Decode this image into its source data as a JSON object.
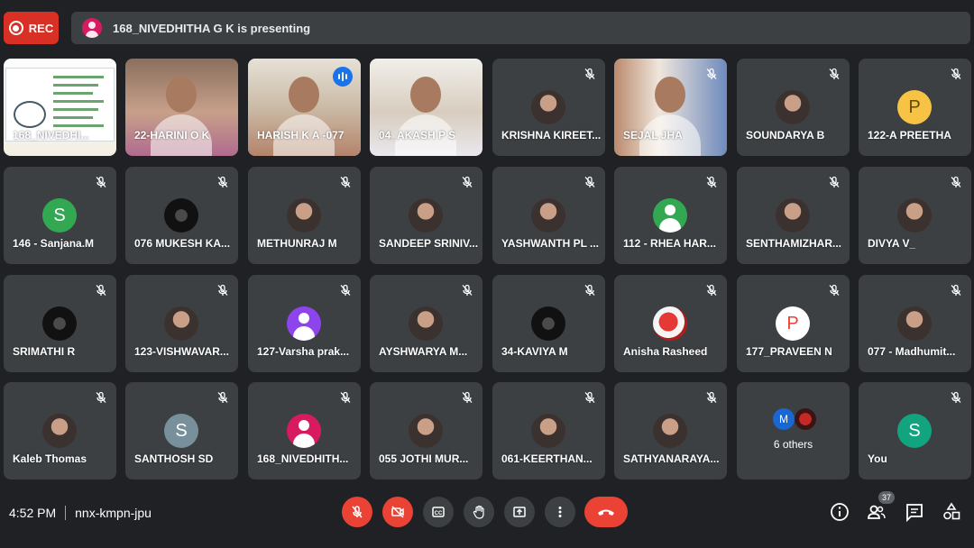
{
  "recording": {
    "label": "REC"
  },
  "presenting": {
    "text": "168_NIVEDHITHA G K is presenting"
  },
  "tiles": [
    {
      "name": "168_NIVEDHI...",
      "type": "screen",
      "muted": false
    },
    {
      "name": "22-HARINI O K",
      "type": "video",
      "muted": false
    },
    {
      "name": "HARISH K A -077",
      "type": "video",
      "muted": false,
      "speaking": true
    },
    {
      "name": "04_AKASH P S",
      "type": "video",
      "muted": false
    },
    {
      "name": "KRISHNA KIREET...",
      "type": "photo",
      "muted": true
    },
    {
      "name": "SEJAL JHA",
      "type": "video",
      "muted": true
    },
    {
      "name": "SOUNDARYA B",
      "type": "photo",
      "muted": true
    },
    {
      "name": "122-A PREETHA",
      "type": "letter",
      "letter": "P",
      "color": "#f6c344",
      "letter_color": "#5f4a00",
      "muted": true
    },
    {
      "name": "146 - Sanjana.M",
      "type": "letter",
      "letter": "S",
      "color": "#33a853",
      "muted": true
    },
    {
      "name": "076 MUKESH KA...",
      "type": "dark",
      "muted": true
    },
    {
      "name": "METHUNRAJ M",
      "type": "photo",
      "muted": true
    },
    {
      "name": "SANDEEP SRINIV...",
      "type": "photo",
      "muted": true
    },
    {
      "name": "YASHWANTH PL ...",
      "type": "photo",
      "muted": true
    },
    {
      "name": "112 - RHEA HAR...",
      "type": "generic-green",
      "muted": true
    },
    {
      "name": "SENTHAMIZHAR...",
      "type": "photo",
      "muted": true
    },
    {
      "name": "DIVYA V_",
      "type": "photo",
      "muted": true
    },
    {
      "name": "SRIMATHI R",
      "type": "dark",
      "muted": true
    },
    {
      "name": "123-VISHWAVAR...",
      "type": "photo",
      "muted": true
    },
    {
      "name": "127-Varsha prak...",
      "type": "generic-purple",
      "muted": true
    },
    {
      "name": "AYSHWARYA M...",
      "type": "photo",
      "muted": true
    },
    {
      "name": "34-KAVIYA M",
      "type": "dark",
      "muted": true
    },
    {
      "name": "Anisha Rasheed",
      "type": "photo-red",
      "muted": true
    },
    {
      "name": "177_PRAVEEN N",
      "type": "letter",
      "letter": "P",
      "color": "#ffffff",
      "letter_color": "#ea4335",
      "muted": true
    },
    {
      "name": "077 - Madhumit...",
      "type": "photo",
      "muted": true
    },
    {
      "name": "Kaleb Thomas",
      "type": "photo",
      "muted": true
    },
    {
      "name": "SANTHOSH SD",
      "type": "letter",
      "letter": "S",
      "color": "#78909c",
      "muted": true
    },
    {
      "name": "168_NIVEDHITH...",
      "type": "generic-pink",
      "muted": true
    },
    {
      "name": "055 JOTHI MUR...",
      "type": "photo",
      "muted": true
    },
    {
      "name": "061-KEERTHAN...",
      "type": "photo",
      "muted": true
    },
    {
      "name": "SATHYANARAYA...",
      "type": "photo",
      "muted": true
    },
    {
      "name": "6 others",
      "type": "others",
      "letter": "M",
      "muted": false
    },
    {
      "name": "You",
      "type": "letter",
      "letter": "S",
      "color": "#12a37f",
      "muted": true
    }
  ],
  "footer": {
    "time": "4:52 PM",
    "meeting_code": "nnx-kmpn-jpu",
    "participants_count": "37"
  },
  "colors": {
    "accent": "#8ab4f8",
    "red": "#ea4335",
    "tile_bg": "#3c4043",
    "page_bg": "#202124"
  }
}
